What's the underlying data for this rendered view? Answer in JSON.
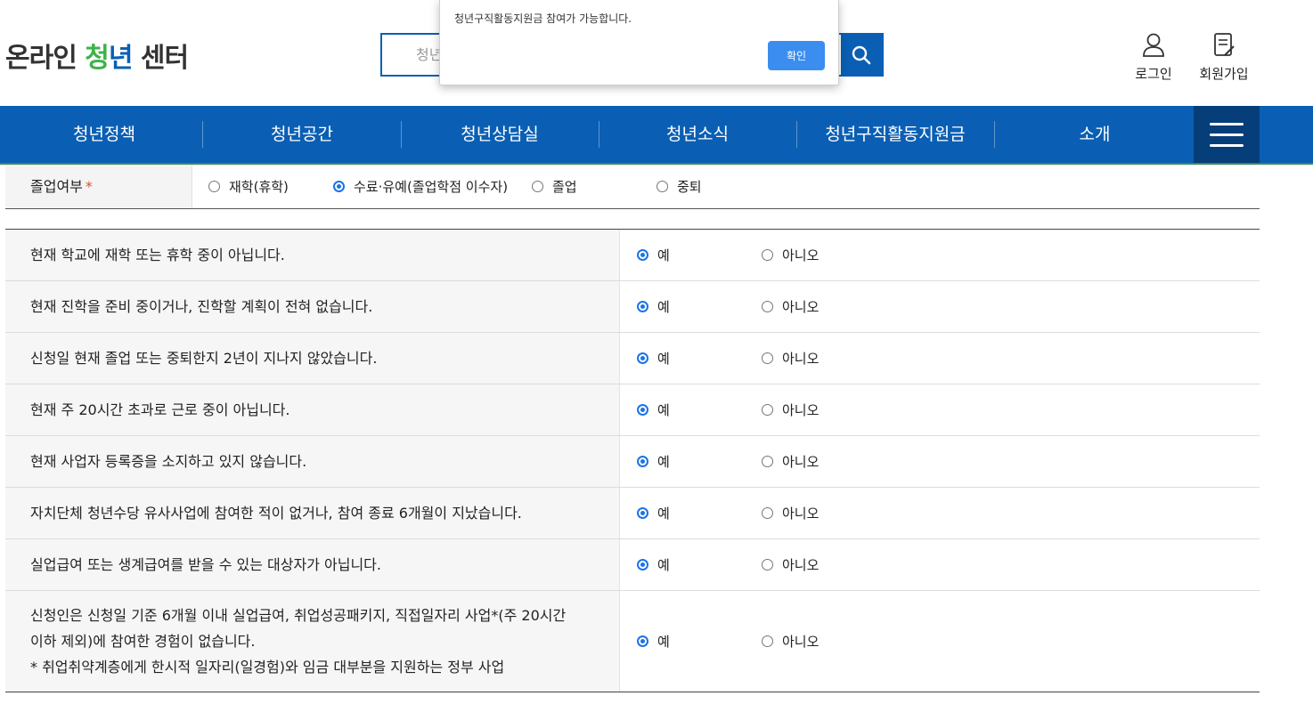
{
  "header": {
    "logo": {
      "part1": "온라인 ",
      "part2": "청",
      "part3": "년",
      "part4": " 센터"
    },
    "search": {
      "placeholder": "청년"
    },
    "login_label": "로그인",
    "signup_label": "회원가입"
  },
  "nav": {
    "items": [
      {
        "label": "청년정책"
      },
      {
        "label": "청년공간"
      },
      {
        "label": "청년상담실"
      },
      {
        "label": "청년소식"
      },
      {
        "label": "청년구직활동지원금"
      },
      {
        "label": "소개"
      }
    ]
  },
  "graduation": {
    "label": "졸업여부",
    "required_mark": "*",
    "options": [
      {
        "label": "재학(휴학)",
        "checked": false
      },
      {
        "label": "수료·유예(졸업학점 이수자)",
        "checked": true
      },
      {
        "label": "졸업",
        "checked": false
      },
      {
        "label": "중퇴",
        "checked": false
      }
    ]
  },
  "questions": [
    {
      "text": "현재 학교에 재학 또는 휴학 중이 아닙니다.",
      "yes": "예",
      "no": "아니오",
      "selected": "yes"
    },
    {
      "text": "현재 진학을 준비 중이거나, 진학할 계획이 전혀 없습니다.",
      "yes": "예",
      "no": "아니오",
      "selected": "yes"
    },
    {
      "text": "신청일 현재 졸업 또는 중퇴한지 2년이 지나지 않았습니다.",
      "yes": "예",
      "no": "아니오",
      "selected": "yes"
    },
    {
      "text": "현재 주 20시간 초과로 근로 중이 아닙니다.",
      "yes": "예",
      "no": "아니오",
      "selected": "yes"
    },
    {
      "text": "현재 사업자 등록증을 소지하고 있지 않습니다.",
      "yes": "예",
      "no": "아니오",
      "selected": "yes"
    },
    {
      "text": "자치단체 청년수당 유사사업에 참여한 적이 없거나, 참여 종료 6개월이 지났습니다.",
      "yes": "예",
      "no": "아니오",
      "selected": "yes"
    },
    {
      "text": "실업급여 또는 생계급여를 받을 수 있는 대상자가 아닙니다.",
      "yes": "예",
      "no": "아니오",
      "selected": "yes"
    },
    {
      "text": "신청인은 신청일 기준 6개월 이내 실업급여, 취업성공패키지, 직접일자리 사업*(주 20시간\n이하 제외)에 참여한 경험이 없습니다.\n* 취업취약계층에게 한시적 일자리(일경험)와 임금 대부분을 지원하는 정부 사업",
      "yes": "예",
      "no": "아니오",
      "selected": "yes"
    }
  ],
  "alert": {
    "message": "청년구직활동지원금 참여가 가능합니다.",
    "confirm_label": "확인"
  },
  "colors": {
    "primary": "#0a5fb4",
    "nav_dark": "#063e7a",
    "required": "#e24a2a",
    "radio_checked": "#1a73e8",
    "alert_button": "#3b8ef0"
  }
}
